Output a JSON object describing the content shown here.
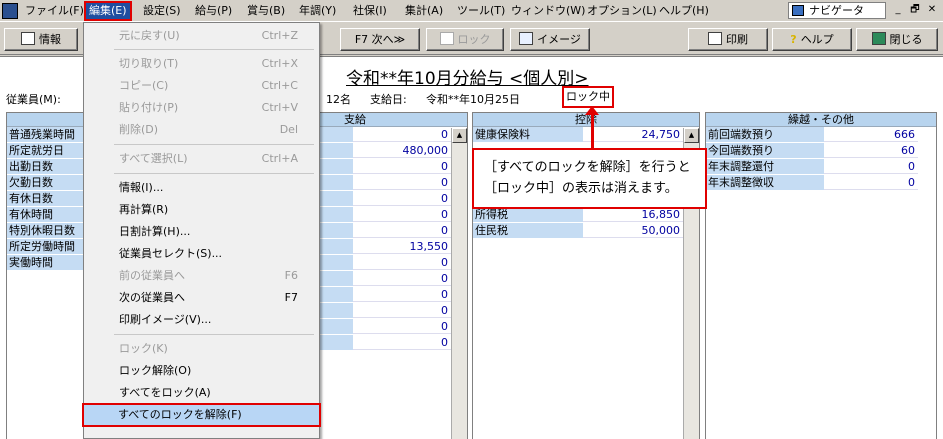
{
  "menubar": {
    "items": [
      "ファイル(F)",
      "編集(E)",
      "設定(S)",
      "給与(P)",
      "賞与(B)",
      "年調(Y)",
      "社保(I)",
      "集計(A)",
      "ツール(T)",
      "ウィンドウ(W)",
      "オプション(L)",
      "ヘルプ(H)"
    ],
    "navigator": "ナビゲータ",
    "win_buttons": [
      "_",
      "🗗",
      "✕"
    ]
  },
  "toolbar": {
    "info": "情報",
    "next": "F7  次へ≫",
    "lock": "ロック",
    "image": "イメージ",
    "print": "印刷",
    "help": "ヘルプ",
    "close": "閉じる"
  },
  "page": {
    "title": "令和**年10月分給与 <個人別>",
    "employee_label": "従業員(M):",
    "count": "12名",
    "payday_label": "支給日:",
    "payday": "令和**年10月25日",
    "lock_status": "ロック中"
  },
  "attendance": {
    "rows": [
      "普通残業時間",
      "所定就労日",
      "出勤日数",
      "欠勤日数",
      "有休日数",
      "有休時間",
      "特別休暇日数",
      "所定労働時間",
      "実働時間"
    ]
  },
  "payment": {
    "header": "支給",
    "values": [
      "0",
      "480,000",
      "0",
      "0",
      "0",
      "0",
      "0",
      "13,550",
      "0",
      "0",
      "0",
      "0",
      "0",
      "0"
    ]
  },
  "deduction": {
    "header": "控除",
    "rows": [
      {
        "label": "健康保険料",
        "value": "24,750"
      },
      {
        "label": "所得税",
        "value": "16,850"
      },
      {
        "label": "住民税",
        "value": "50,000"
      }
    ]
  },
  "other": {
    "header": "繰越・その他",
    "rows": [
      {
        "label": "前回端数預り",
        "value": "666"
      },
      {
        "label": "今回端数預り",
        "value": "60"
      },
      {
        "label": "年末調整還付",
        "value": "0"
      },
      {
        "label": "年末調整徴収",
        "value": "0"
      }
    ]
  },
  "edit_menu": {
    "items": [
      {
        "label": "元に戻す(U)",
        "shortcut": "Ctrl+Z",
        "disabled": true
      },
      {
        "label": "切り取り(T)",
        "shortcut": "Ctrl+X",
        "disabled": true
      },
      {
        "label": "コピー(C)",
        "shortcut": "Ctrl+C",
        "disabled": true
      },
      {
        "label": "貼り付け(P)",
        "shortcut": "Ctrl+V",
        "disabled": true
      },
      {
        "label": "削除(D)",
        "shortcut": "Del",
        "disabled": true
      },
      {
        "label": "すべて選択(L)",
        "shortcut": "Ctrl+A",
        "disabled": true
      },
      {
        "label": "情報(I)...",
        "shortcut": "",
        "disabled": false
      },
      {
        "label": "再計算(R)",
        "shortcut": "",
        "disabled": false
      },
      {
        "label": "日割計算(H)...",
        "shortcut": "",
        "disabled": false
      },
      {
        "label": "従業員セレクト(S)...",
        "shortcut": "",
        "disabled": false
      },
      {
        "label": "前の従業員へ",
        "shortcut": "F6",
        "disabled": true
      },
      {
        "label": "次の従業員へ",
        "shortcut": "F7",
        "disabled": false
      },
      {
        "label": "印刷イメージ(V)...",
        "shortcut": "",
        "disabled": false
      },
      {
        "label": "ロック(K)",
        "shortcut": "",
        "disabled": true
      },
      {
        "label": "ロック解除(O)",
        "shortcut": "",
        "disabled": false
      },
      {
        "label": "すべてをロック(A)",
        "shortcut": "",
        "disabled": false
      },
      {
        "label": "すべてのロックを解除(F)",
        "shortcut": "",
        "disabled": false
      }
    ]
  },
  "callout": {
    "line1": "［すべてのロックを解除］を行うと",
    "line2": "［ロック中］の表示は消えます。"
  },
  "colors": {
    "highlight": "#e00000",
    "label_bg": "#c5dcf3",
    "value_text": "#0000a0"
  }
}
